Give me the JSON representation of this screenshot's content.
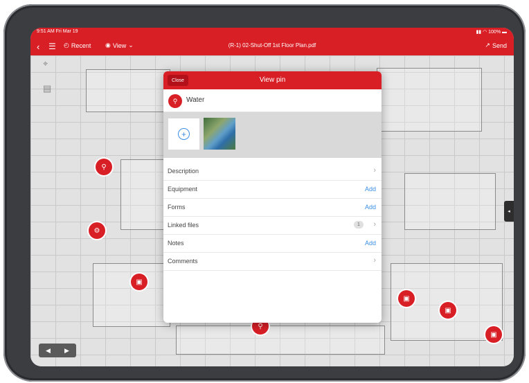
{
  "status_bar": {
    "time": "9:51 AM  Fri Mar 19",
    "battery": "100%"
  },
  "toolbar": {
    "recent_label": "Recent",
    "view_label": "View",
    "file_title": "(R-1) 02-Shut-Off 1st Floor Plan.pdf",
    "send_label": "Send"
  },
  "modal": {
    "close_label": "Close",
    "title": "View pin",
    "pin_type": "Water",
    "rows": [
      {
        "label": "Description",
        "action": "",
        "chevron": true
      },
      {
        "label": "Equipment",
        "action": "Add",
        "chevron": false
      },
      {
        "label": "Forms",
        "action": "Add",
        "chevron": false
      },
      {
        "label": "Linked files",
        "action": "",
        "count": "1",
        "chevron": true
      },
      {
        "label": "Notes",
        "action": "Add",
        "chevron": false
      },
      {
        "label": "Comments",
        "action": "",
        "chevron": true
      }
    ]
  },
  "colors": {
    "brand_red": "#d81f26",
    "link_blue": "#3a8ee6"
  },
  "icons": [
    "back-chevron-icon",
    "menu-icon",
    "recent-clock-icon",
    "eye-icon",
    "chevron-down-icon",
    "send-icon",
    "location-pin-icon",
    "document-icon",
    "water-tap-icon",
    "plus-icon",
    "left-arrow-icon",
    "right-arrow-icon"
  ]
}
